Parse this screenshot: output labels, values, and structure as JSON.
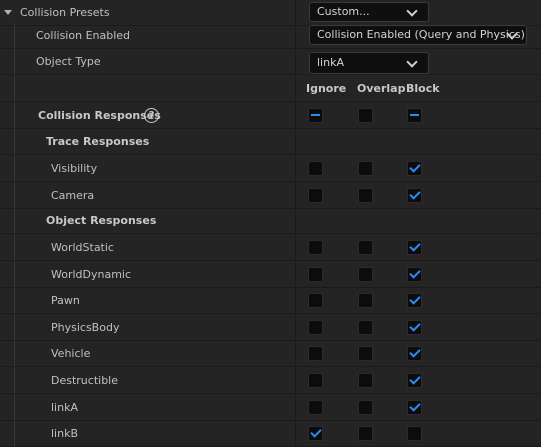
{
  "presets": {
    "label": "Collision Presets",
    "value": "Custom..."
  },
  "collision_enabled": {
    "label": "Collision Enabled",
    "value": "Collision Enabled (Query and Physics)"
  },
  "object_type": {
    "label": "Object Type",
    "value": "linkA"
  },
  "columns": {
    "ignore": "Ignore",
    "overlap": "Overlap",
    "block": "Block"
  },
  "responses": {
    "label": "Collision Responses",
    "help": "?",
    "all": "block-mixed"
  },
  "trace_section": "Trace Responses",
  "trace": [
    {
      "label": "Visibility",
      "response": "block"
    },
    {
      "label": "Camera",
      "response": "block"
    }
  ],
  "object_section": "Object Responses",
  "object": [
    {
      "label": "WorldStatic",
      "response": "block"
    },
    {
      "label": "WorldDynamic",
      "response": "block"
    },
    {
      "label": "Pawn",
      "response": "block"
    },
    {
      "label": "PhysicsBody",
      "response": "block"
    },
    {
      "label": "Vehicle",
      "response": "block"
    },
    {
      "label": "Destructible",
      "response": "block"
    },
    {
      "label": "linkA",
      "response": "block"
    },
    {
      "label": "linkB",
      "response": "ignore"
    }
  ],
  "colors": {
    "background": "#242424",
    "check": "#2a8cf0",
    "field": "#0f0f0f"
  },
  "icons": {
    "expand": "triangle-down-icon",
    "dropdown": "chevron-down-icon",
    "help": "question-circle-icon"
  }
}
